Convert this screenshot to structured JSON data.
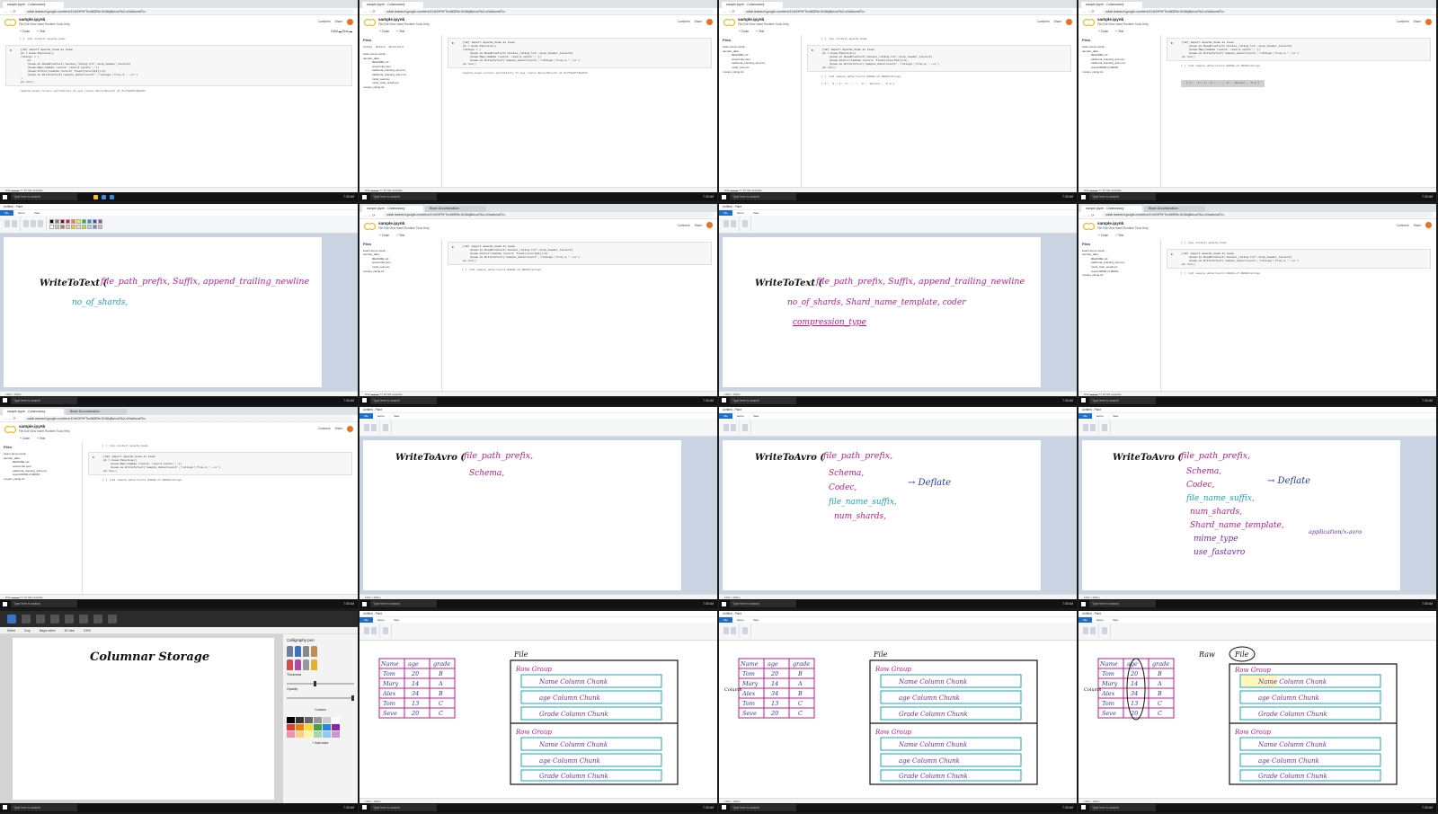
{
  "colors": {
    "colab_orange": "#f9ab00",
    "ink_pink": "#c2188f",
    "ink_blue": "#1f3aa8",
    "ink_teal": "#1aa3b8",
    "ink_purple": "#6a2bb0",
    "ink_black": "#111111"
  },
  "taskbar": {
    "search_placeholder": "Type here to search"
  },
  "browser": {
    "tab_title": "sample.ipynb - Colaboratory",
    "tab2_title": "Beam Documentation",
    "url": "colab.research.google.com/drive/1VxK0iFHF7bcM0fE5n1fLN8qBw/ccdTsU-sVhs#scrollTo=",
    "nav_icons": "← → ⟳"
  },
  "notebook": {
    "title": "sample.ipynb",
    "menu": "File  Edit  View  Insert  Runtime  Tools  Help",
    "menu_saved": "All changes saved",
    "comment": "Comment",
    "share": "Share",
    "ram": "RAM ▬ Disk ▬",
    "editing": "Editing",
    "code_btn": "+ Code",
    "text_btn": "+ Text",
    "files_title": "Files",
    "upload": "Upload",
    "refresh": "Refresh",
    "mount": "Mount Drive",
    "files": [
      "beam-temp-result-...",
      "sample_data",
      "README.md",
      "anscombe.json",
      "california_housing_test.csv",
      "california_housing_train.csv",
      "mnist_test.csv",
      "mnist_train_small.csv",
      "result-00000-of-00001",
      "movies_rating.txt"
    ],
    "cell1": "[ ] !pip install apache_beam",
    "code": [
      "[42] import apache_beam as beam",
      "p1 = beam.Pipeline()",
      "ratings = (",
      "    p1",
      "    |beam.io.ReadFromText('movies_rating.txt',skip_header_lines=1)",
      "    |beam.Map(lambda record: record.split(','))",
      "    |beam.Filter(lambda record: float(record[2])>4)",
      "    |beam.io.WriteToText('sample_data/result','ratings',True,1,'--xx')",
      ")",
      "p1.run()"
    ],
    "run_output": "<apache_beam.runners.portability.fn_api_runner.RunnerResult at 0x7fa64fc6d4b0>",
    "cat_cmd": "[ ] !cat sample_data/result-00000-of-00001ratings",
    "cat_output": "['1', '4','1','1','..', '2', 'Hiroko', '5.0']",
    "disk": "Disk ▬▬▬ 77.18 GB available"
  },
  "paint": {
    "title": "Untitled - Paint",
    "tabs": [
      "File",
      "Home",
      "View"
    ],
    "status": "1118 × 489px",
    "zoom": "100%"
  },
  "handwriting": {
    "wtt_head": "WriteToText (",
    "wtt_line1": "file_path_prefix, Suffix, append_trailing_newline",
    "wtt_line2_a": "no_of_shards,",
    "wtt_line2_b": "no_of_shards, Shard_name_template, coder",
    "wtt_line3": "compression_type",
    "wta_head": "WriteToAvro (",
    "wta_params": [
      "file_path_prefix,",
      "Schema,",
      "Codec,",
      "file_name_suffix,",
      "num_shards,",
      "Shard_name_template,",
      "mime_type",
      "use_fastavro"
    ],
    "deflate": "→ Deflate",
    "avro_mime": "application/x-avro",
    "columnar": "Columnar Storage",
    "table_headers": [
      "Name",
      "age",
      "grade"
    ],
    "table_rows": [
      [
        "Tom",
        "20",
        "B"
      ],
      [
        "Mary",
        "14",
        "A"
      ],
      [
        "Alex",
        "34",
        "B"
      ],
      [
        "Tom",
        "13",
        "C"
      ],
      [
        "Seve",
        "20",
        "C"
      ]
    ],
    "file_label": "File",
    "row_group": "Row Group",
    "chunks": [
      "Name Column Chunk",
      "age Column Chunk",
      "Grade Column Chunk"
    ],
    "raw": "Raw",
    "column": "Column"
  },
  "paint3d": {
    "title": "Untitled - Paint 3D",
    "tools": [
      "Brushes",
      "2D shapes",
      "3D shapes",
      "Stickers",
      "Text",
      "Effects",
      "Canvas",
      "3D library"
    ],
    "sub": [
      "Select",
      "Crop",
      "Magic select",
      "3D view",
      "100%"
    ],
    "panel_title": "Calligraphy pen",
    "thickness": "Thickness",
    "opacity": "Opacity",
    "custom": "Custom",
    "add_color": "+ Add color"
  },
  "clock": "7:35 AM"
}
